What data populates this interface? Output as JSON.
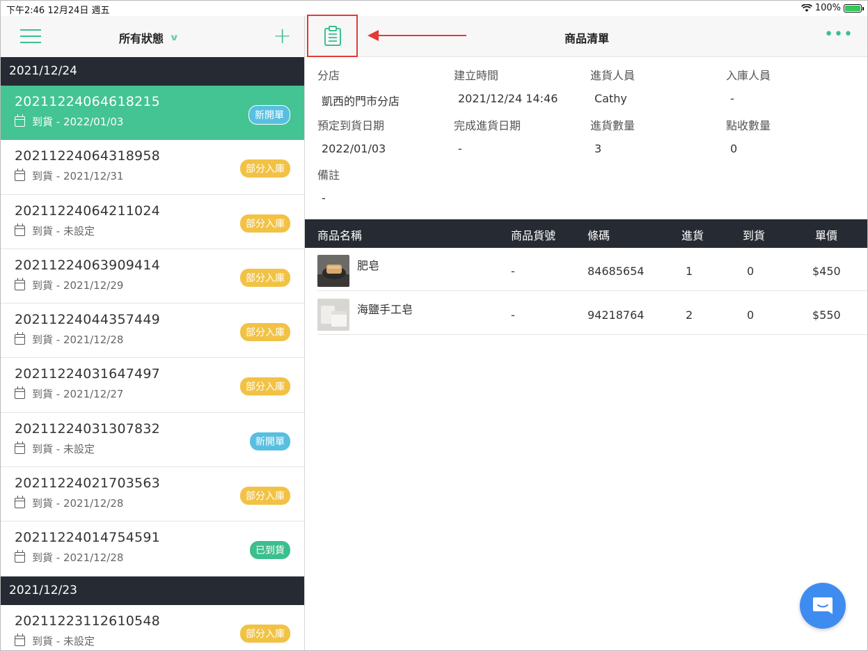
{
  "status_bar": {
    "time_date": "下午2:46   12月24日 週五",
    "battery": "100%"
  },
  "left": {
    "filter_label": "所有狀態",
    "groups": [
      {
        "date": "2021/12/24",
        "orders": [
          {
            "id": "20211224064618215",
            "arrival": "到貨 - 2022/01/03",
            "status": "新開單",
            "kind": "new",
            "selected": true
          },
          {
            "id": "20211224064318958",
            "arrival": "到貨 - 2021/12/31",
            "status": "部分入庫",
            "kind": "partial"
          },
          {
            "id": "20211224064211024",
            "arrival": "到貨 - 未設定",
            "status": "部分入庫",
            "kind": "partial"
          },
          {
            "id": "20211224063909414",
            "arrival": "到貨 - 2021/12/29",
            "status": "部分入庫",
            "kind": "partial"
          },
          {
            "id": "20211224044357449",
            "arrival": "到貨 - 2021/12/28",
            "status": "部分入庫",
            "kind": "partial"
          },
          {
            "id": "20211224031647497",
            "arrival": "到貨 - 2021/12/27",
            "status": "部分入庫",
            "kind": "partial"
          },
          {
            "id": "20211224031307832",
            "arrival": "到貨 - 未設定",
            "status": "新開單",
            "kind": "new"
          },
          {
            "id": "20211224021703563",
            "arrival": "到貨 - 2021/12/28",
            "status": "部分入庫",
            "kind": "partial"
          },
          {
            "id": "20211224014754591",
            "arrival": "到貨 - 2021/12/28",
            "status": "已到貨",
            "kind": "arrived"
          }
        ]
      },
      {
        "date": "2021/12/23",
        "orders": [
          {
            "id": "20211223112610548",
            "arrival": "到貨 - 未設定",
            "status": "部分入庫",
            "kind": "partial"
          }
        ]
      }
    ]
  },
  "right": {
    "title": "商品清單",
    "info": [
      {
        "label": "分店",
        "value": "凱西的門市分店"
      },
      {
        "label": "建立時間",
        "value": "2021/12/24 14:46"
      },
      {
        "label": "進貨人員",
        "value": "Cathy"
      },
      {
        "label": "入庫人員",
        "value": "-"
      },
      {
        "label": "預定到貨日期",
        "value": "2022/01/03"
      },
      {
        "label": "完成進貨日期",
        "value": "-"
      },
      {
        "label": "進貨數量",
        "value": "3"
      },
      {
        "label": "點收數量",
        "value": "0"
      },
      {
        "label": "備註",
        "value": "-"
      }
    ],
    "table": {
      "headers": [
        "商品名稱",
        "商品貨號",
        "條碼",
        "進貨",
        "到貨",
        "單價"
      ],
      "rows": [
        {
          "name": "肥皂",
          "sku": "-",
          "barcode": "84685654",
          "incoming": "1",
          "arrived": "0",
          "price": "$450"
        },
        {
          "name": "海鹽手工皂",
          "sku": "-",
          "barcode": "94218764",
          "incoming": "2",
          "arrived": "0",
          "price": "$550"
        }
      ]
    }
  },
  "colors": {
    "accent": "#3cbf8f",
    "selected_row": "#44c393",
    "dark_header": "#262b33",
    "partial_badge": "#f2c244",
    "new_badge": "#58bfe0",
    "highlight_box": "#e53935",
    "chat_button": "#3f8cf0"
  },
  "icons": [
    "hamburger-menu-icon",
    "chevron-down-icon",
    "plus-icon",
    "clipboard-icon",
    "more-dots-icon",
    "calendar-icon",
    "wifi-icon",
    "battery-icon",
    "chat-icon"
  ]
}
